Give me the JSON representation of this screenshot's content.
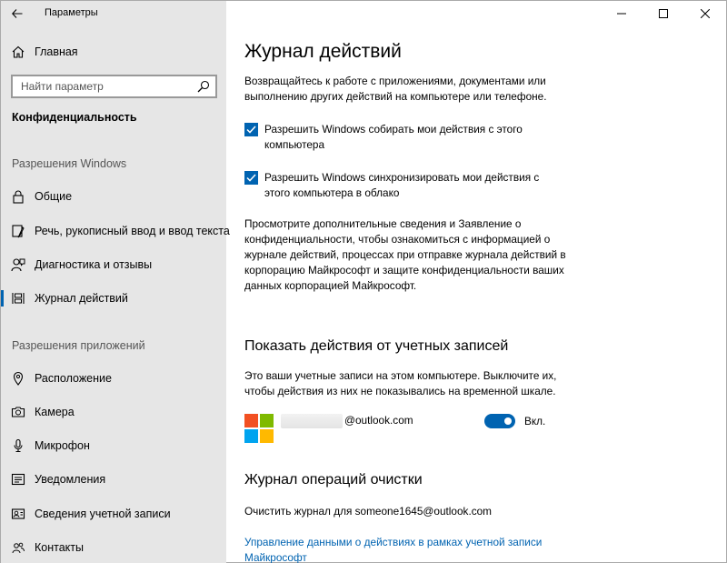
{
  "window": {
    "title": "Параметры"
  },
  "sidebar": {
    "home_label": "Главная",
    "search_placeholder": "Найти параметр",
    "category": "Конфиденциальность",
    "section_windows": "Разрешения Windows",
    "section_apps": "Разрешения приложений",
    "items": [
      {
        "label": "Общие",
        "icon": "lock-icon"
      },
      {
        "label": "Речь, рукописный ввод и ввод текста",
        "icon": "pen-icon"
      },
      {
        "label": "Диагностика и отзывы",
        "icon": "feedback-icon"
      },
      {
        "label": "Журнал действий",
        "icon": "timeline-icon",
        "active": true
      },
      {
        "label": "Расположение",
        "icon": "location-icon"
      },
      {
        "label": "Камера",
        "icon": "camera-icon"
      },
      {
        "label": "Микрофон",
        "icon": "microphone-icon"
      },
      {
        "label": "Уведомления",
        "icon": "notification-icon"
      },
      {
        "label": "Сведения учетной записи",
        "icon": "account-icon"
      },
      {
        "label": "Контакты",
        "icon": "contacts-icon"
      }
    ]
  },
  "main": {
    "title": "Журнал действий",
    "intro": "Возвращайтесь к работе с приложениями, документами или выполнению других действий на компьютере или телефоне.",
    "checkbox1": "Разрешить Windows собирать мои действия с этого компьютера",
    "checkbox2": "Разрешить Windows синхронизировать мои действия с этого компьютера в облако",
    "privacy_text": "Просмотрите дополнительные сведения и Заявление о конфиденциальности, чтобы ознакомиться с информацией о журнале действий, процессах при отправке журнала действий в корпорацию Майкрософт и защите конфиденциальности ваших данных корпорацией Майкрософт.",
    "accounts_heading": "Показать действия от учетных записей",
    "accounts_text": "Это ваши учетные записи на этом компьютере. Выключите их, чтобы действия из них не показывались на временной шкале.",
    "account_email": "@outlook.com",
    "toggle_label": "Вкл.",
    "clear_heading": "Журнал операций очистки",
    "clear_text": "Очистить журнал для someone1645@outlook.com",
    "manage_link": "Управление данными о действиях в рамках учетной записи Майкрософт"
  },
  "colors": {
    "accent": "#0063b1",
    "sidebar_bg": "#e6e6e6",
    "ms_red": "#f25022",
    "ms_green": "#7fba00",
    "ms_blue": "#00a4ef",
    "ms_yellow": "#ffb900"
  }
}
